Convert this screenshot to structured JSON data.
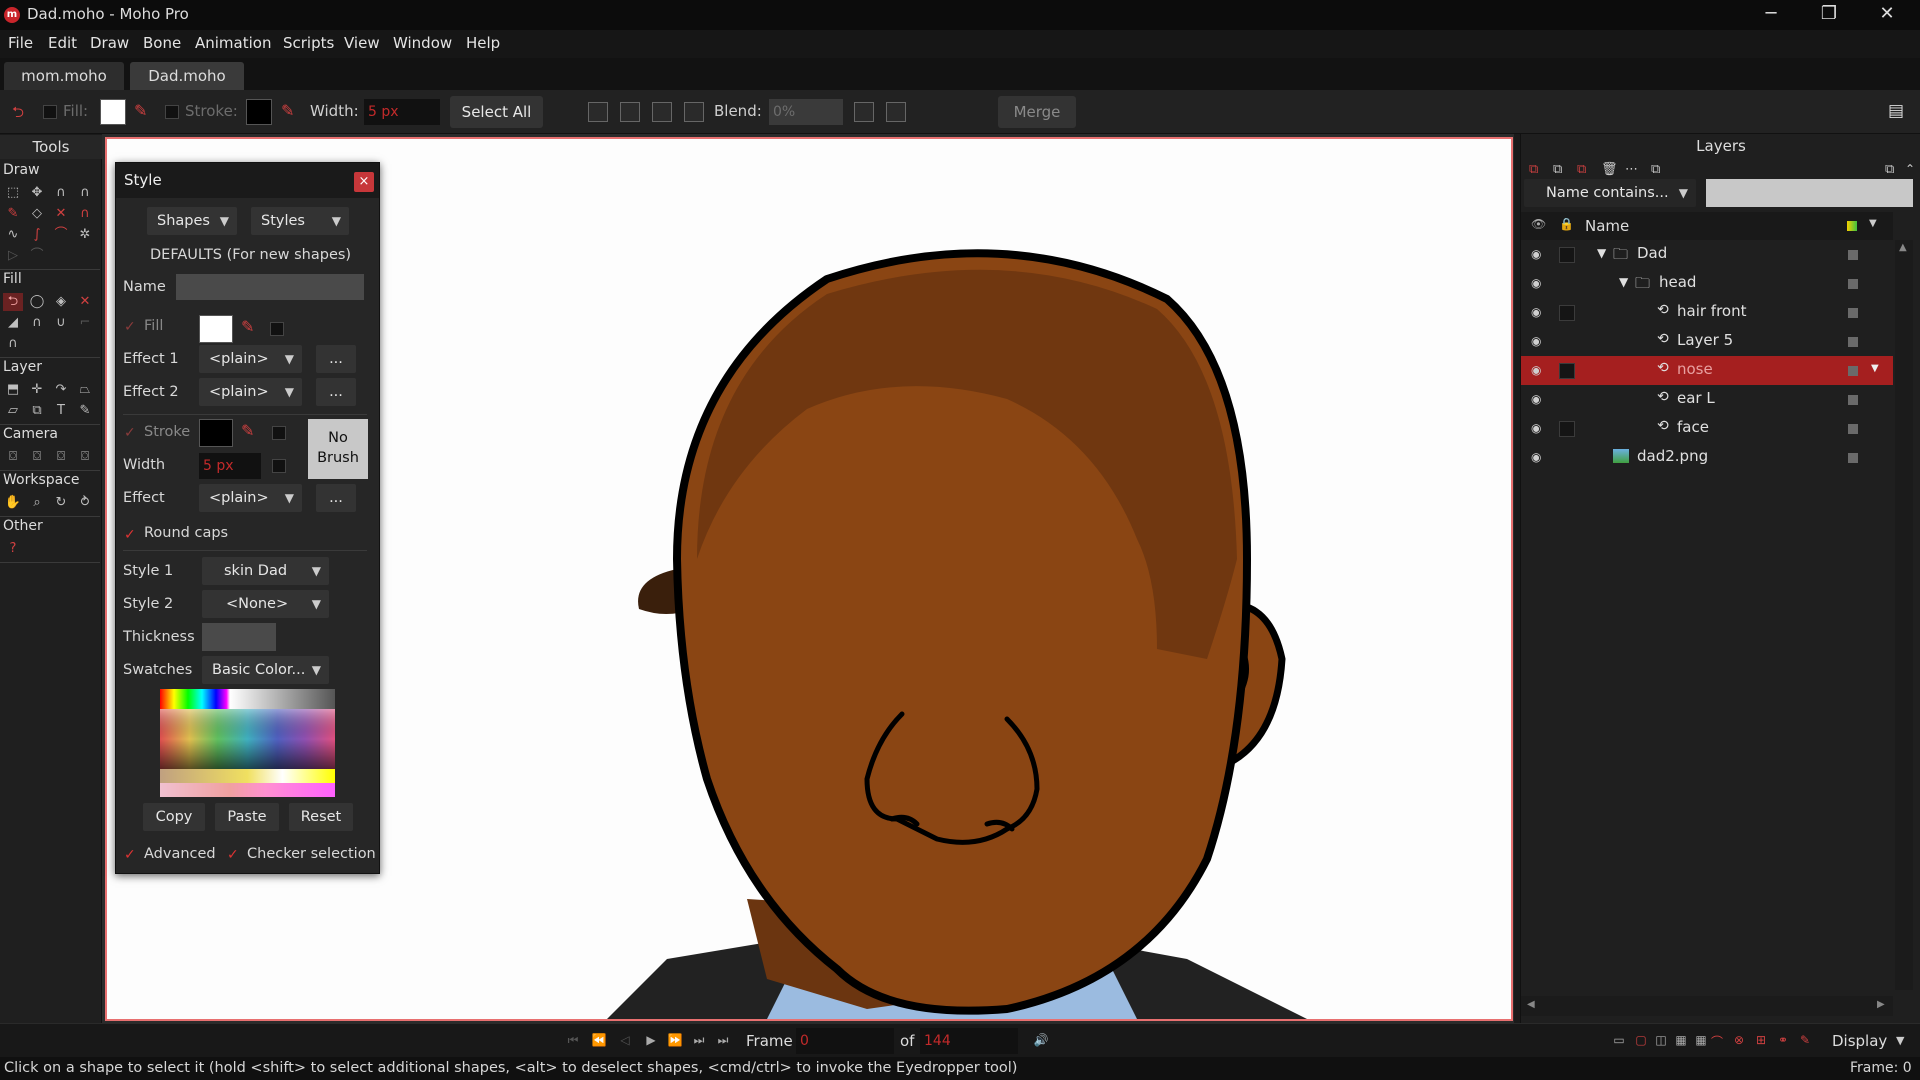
{
  "window": {
    "title": "Dad.moho - Moho Pro",
    "app_icon_letter": "m",
    "minimize": "─",
    "maximize": "❐",
    "close": "✕"
  },
  "menu": [
    "File",
    "Edit",
    "Draw",
    "Bone",
    "Animation",
    "Scripts",
    "View",
    "Window",
    "Help"
  ],
  "doc_tabs": [
    "mom.moho",
    "Dad.moho"
  ],
  "toolbar": {
    "fill_label": "Fill:",
    "stroke_label": "Stroke:",
    "width_label": "Width:",
    "width_value": "5 px",
    "select_all": "Select All",
    "blend_label": "Blend:",
    "blend_value": "0%",
    "merge": "Merge"
  },
  "tools": {
    "title": "Tools",
    "sections": [
      "Draw",
      "Fill",
      "Layer",
      "Camera",
      "Workspace",
      "Other"
    ],
    "other_item": "?"
  },
  "style_panel": {
    "title": "Style",
    "close": "×",
    "shapes_dd": "Shapes",
    "styles_dd": "Styles",
    "defaults": "DEFAULTS (For new shapes)",
    "name_label": "Name",
    "fill_label": "Fill",
    "effect1_label": "Effect 1",
    "effect1_value": "<plain>",
    "effect2_label": "Effect 2",
    "effect2_value": "<plain>",
    "more": "...",
    "stroke_label": "Stroke",
    "width_label": "Width",
    "width_value": "5 px",
    "no_brush_line1": "No",
    "no_brush_line2": "Brush",
    "effect_label": "Effect",
    "effect_value": "<plain>",
    "round_caps": "Round caps",
    "style1_label": "Style 1",
    "style1_value": "skin Dad",
    "style2_label": "Style 2",
    "style2_value": "<None>",
    "thickness_label": "Thickness",
    "swatches_label": "Swatches",
    "swatches_value": "Basic Color...",
    "copy": "Copy",
    "paste": "Paste",
    "reset": "Reset",
    "advanced": "Advanced",
    "checker_selection": "Checker selection",
    "check_mark": "✓",
    "dropdown_arrow": "▼"
  },
  "layers": {
    "title": "Layers",
    "filter_value": "Name contains...",
    "name_header": "Name",
    "items": [
      {
        "name": "Dad",
        "type": "group-open",
        "indent": 0
      },
      {
        "name": "head",
        "type": "group-open",
        "indent": 1
      },
      {
        "name": "hair front",
        "type": "vector",
        "indent": 2
      },
      {
        "name": "Layer 5",
        "type": "vector",
        "indent": 2
      },
      {
        "name": "nose",
        "type": "vector",
        "indent": 2,
        "selected": true
      },
      {
        "name": "ear L",
        "type": "vector",
        "indent": 2
      },
      {
        "name": "face",
        "type": "vector",
        "indent": 2
      },
      {
        "name": "dad2.png",
        "type": "image",
        "indent": 1
      }
    ]
  },
  "timeline": {
    "frame_label": "Frame",
    "frame_value": "0",
    "of_label": "of",
    "total_frames": "144",
    "display": "Display"
  },
  "status": {
    "hint": "Click on a shape to select it (hold <shift> to select additional shapes, <alt> to deselect shapes, <cmd/ctrl> to invoke the Eyedropper tool)",
    "frame": "Frame: 0"
  },
  "colors": {
    "accent": "#c7373a",
    "selected_layer": "#a51f1f",
    "skin": "#8a4513",
    "hair": "#6b3510",
    "shirt": "#9bbbe0",
    "suit": "#222222"
  }
}
